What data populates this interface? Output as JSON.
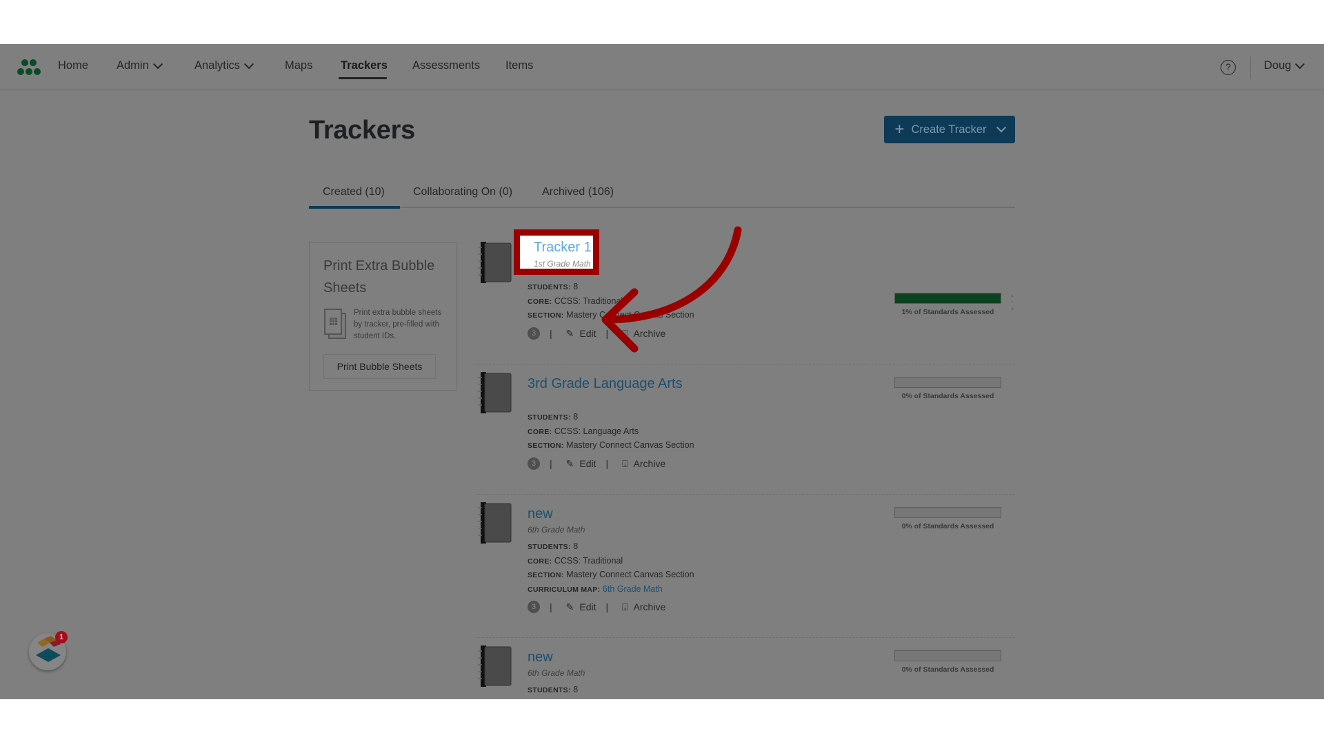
{
  "nav": {
    "items": [
      {
        "label": "Home"
      },
      {
        "label": "Admin",
        "has_dropdown": true
      },
      {
        "label": "Analytics",
        "has_dropdown": true
      },
      {
        "label": "Maps"
      },
      {
        "label": "Trackers",
        "active": true
      },
      {
        "label": "Assessments"
      },
      {
        "label": "Items"
      }
    ],
    "help_icon": "?",
    "user_name": "Doug"
  },
  "page": {
    "title": "Trackers",
    "create_button_label": "Create Tracker",
    "create_button_icon": "+"
  },
  "tabs": [
    {
      "label": "Created (10)",
      "active": true
    },
    {
      "label": "Collaborating On (0)"
    },
    {
      "label": "Archived (106)"
    }
  ],
  "sidebar": {
    "title": "Print Extra Bubble Sheets",
    "description": "Print extra bubble sheets by tracker, pre-filled with student IDs.",
    "button_label": "Print Bubble Sheets"
  },
  "labels": {
    "students": "STUDENTS:",
    "core": "CORE:",
    "section": "SECTION:",
    "curriculum_map": "CURRICULUM MAP:",
    "edit": "Edit",
    "archive": "Archive",
    "separator": "|"
  },
  "trackers": [
    {
      "title": "Tracker 1",
      "subtitle": "1st Grade Math",
      "students": "8",
      "core": "CCSS: Traditional",
      "section": "Mastery Connect Canvas Section",
      "badge_count": "3",
      "progress_percent": 1,
      "progress_label": "1% of Standards Assessed",
      "highlighted": true
    },
    {
      "title": "3rd Grade Language Arts",
      "subtitle": "",
      "students": "8",
      "core": "CCSS: Language Arts",
      "section": "Mastery Connect Canvas Section",
      "badge_count": "3",
      "progress_percent": 0,
      "progress_label": "0% of Standards Assessed"
    },
    {
      "title": "new",
      "subtitle": "6th Grade Math",
      "students": "8",
      "core": "CCSS: Traditional",
      "section": "Mastery Connect Canvas Section",
      "curriculum_map": "6th Grade Math",
      "badge_count": "3",
      "progress_percent": 0,
      "progress_label": "0% of Standards Assessed"
    },
    {
      "title": "new",
      "subtitle": "6th Grade Math",
      "students": "8",
      "progress_percent": 0,
      "progress_label": "0% of Standards Assessed"
    }
  ],
  "widget": {
    "notification_count": "1"
  },
  "colors": {
    "brand_green": "#0b4a27",
    "primary_button": "#0d3a57",
    "link": "#1d4f6e",
    "annotation_red": "#9a0000",
    "progress_fill": "#0b421f"
  }
}
